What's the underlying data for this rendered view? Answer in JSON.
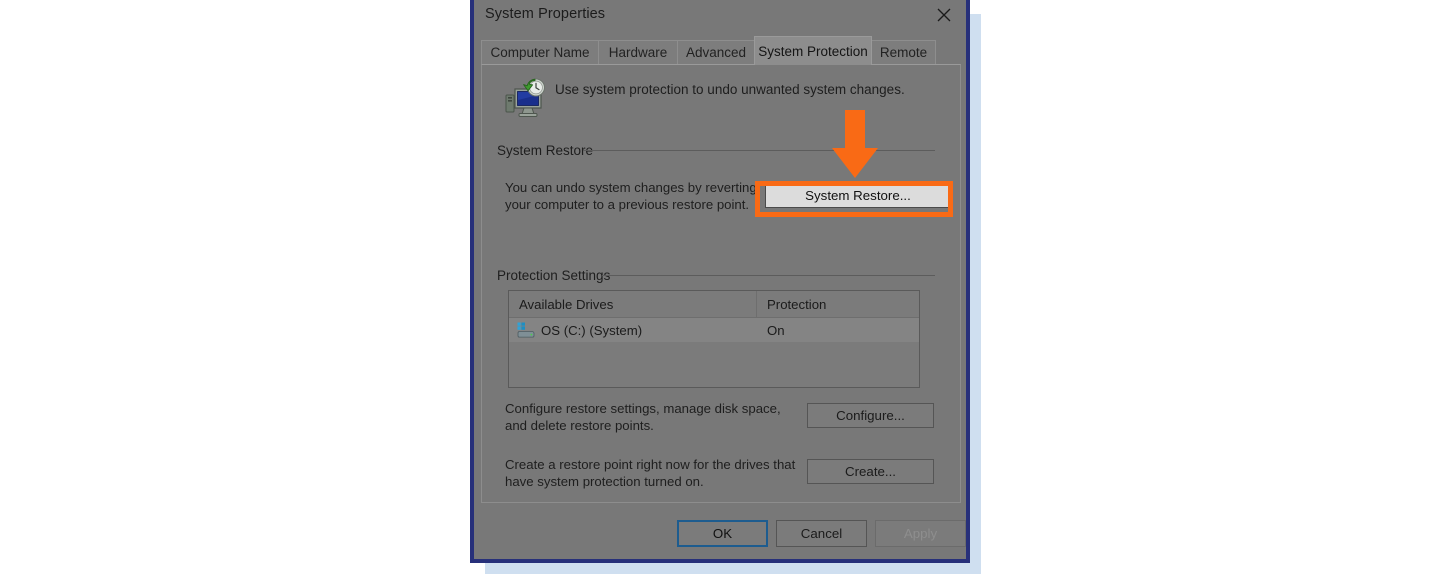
{
  "window": {
    "title": "System Properties",
    "close_label": "✕"
  },
  "tabs": [
    {
      "label": "Computer Name",
      "selected": false
    },
    {
      "label": "Hardware",
      "selected": false
    },
    {
      "label": "Advanced",
      "selected": false
    },
    {
      "label": "System Protection",
      "selected": true
    },
    {
      "label": "Remote",
      "selected": false
    }
  ],
  "header": {
    "description": "Use system protection to undo unwanted system changes.",
    "icon": "system-protection-icon"
  },
  "system_restore": {
    "group_label": "System Restore",
    "description": "You can undo system changes by reverting\nyour computer to a previous restore point.",
    "button_label": "System Restore..."
  },
  "protection_settings": {
    "group_label": "Protection Settings",
    "columns": [
      "Available Drives",
      "Protection"
    ],
    "rows": [
      {
        "drive": "OS (C:) (System)",
        "protection": "On",
        "icon": "hard-drive-icon",
        "selected": true
      }
    ],
    "configure": {
      "description": "Configure restore settings, manage disk space,\nand delete restore points.",
      "button_label": "Configure..."
    },
    "create": {
      "description": "Create a restore point right now for the drives that\nhave system protection turned on.",
      "button_label": "Create..."
    }
  },
  "footer": {
    "ok_label": "OK",
    "cancel_label": "Cancel",
    "apply_label": "Apply",
    "apply_disabled": true
  },
  "annotation": {
    "type": "arrow-and-highlight",
    "color": "#f96a15",
    "target": "System Restore..."
  },
  "colors": {
    "window_border": "#27307a",
    "window_face": "#787878",
    "backdrop_shadow": "#cfdff0",
    "highlight_orange": "#f96a15",
    "focus_blue": "#1d5c8f"
  }
}
